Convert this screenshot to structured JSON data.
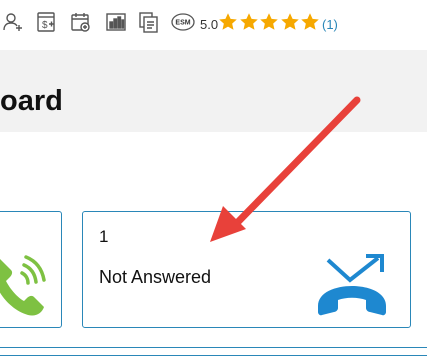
{
  "toolbar": {
    "icons": [
      "add-user-icon",
      "add-invoice-icon",
      "add-calendar-event-icon",
      "bar-chart-icon",
      "copy-documents-icon",
      "esm-badge-icon"
    ],
    "esm_badge": "ESM",
    "rating_value": "5.0",
    "rating_stars": 5,
    "rating_count": "(1)",
    "star_color": "#f6a800"
  },
  "page": {
    "title": "oard"
  },
  "cards": {
    "missed": {
      "count": "1",
      "label": "Not Answered",
      "icon": "missed-call-icon",
      "icon_color": "#1e88d0"
    },
    "answered_partial": {
      "icon": "incoming-call-icon",
      "icon_color": "#7ec142"
    }
  },
  "annotation": {
    "arrow_color": "#e8413a"
  }
}
